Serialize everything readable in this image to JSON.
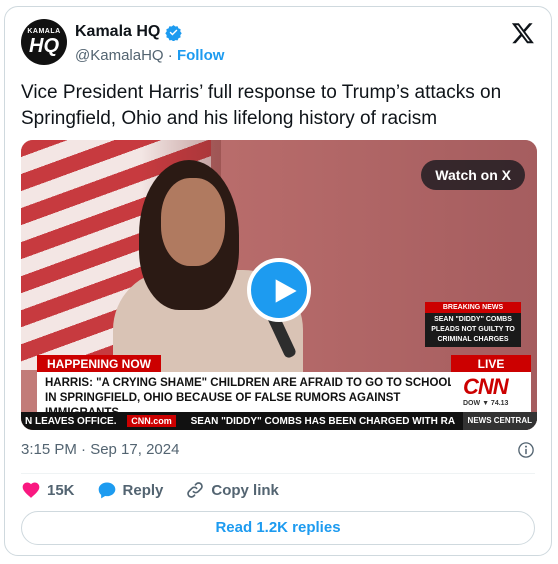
{
  "author": {
    "name": "Kamala HQ",
    "handle": "@KamalaHQ",
    "separator": "·",
    "follow_label": "Follow",
    "avatar_small_text": "KAMALA",
    "avatar_big_text": "HQ"
  },
  "tweet": {
    "text": "Vice President Harris’ full response to Trump’s attacks on Springfield, Ohio and his lifelong history of racism"
  },
  "media": {
    "watch_label": "Watch on X",
    "breaking_header": "BREAKING NEWS",
    "breaking_body": "SEAN \"DIDDY\" COMBS PLEADS NOT GUILTY TO CRIMINAL CHARGES",
    "happening_now": "HAPPENING NOW",
    "live": "LIVE",
    "lower_third_line1": "HARRIS: \"A CRYING SHAME\" CHILDREN ARE AFRAID TO GO TO SCHOOL",
    "lower_third_line2": "IN SPRINGFIELD, OHIO BECAUSE OF FALSE RUMORS AGAINST IMMIGRANTS",
    "network_logo": "CNN",
    "dow_label": "DOW",
    "dow_value": "▼ 74.13",
    "ticker_left": "N LEAVES OFFICE.",
    "ticker_site": "CNN.com",
    "ticker_right": "SEAN \"DIDDY\" COMBS HAS BEEN CHARGED WITH RA",
    "ticker_badge": "NEWS CENTRAL"
  },
  "meta": {
    "timestamp": "3:15 PM · Sep 17, 2024"
  },
  "actions": {
    "likes": "15K",
    "reply_label": "Reply",
    "copy_label": "Copy link"
  },
  "read_replies_label": "Read 1.2K replies",
  "colors": {
    "accent": "#1d9bf0",
    "like": "#f91880",
    "text": "#0f1419",
    "muted": "#536471",
    "cnn_red": "#cc0000"
  }
}
